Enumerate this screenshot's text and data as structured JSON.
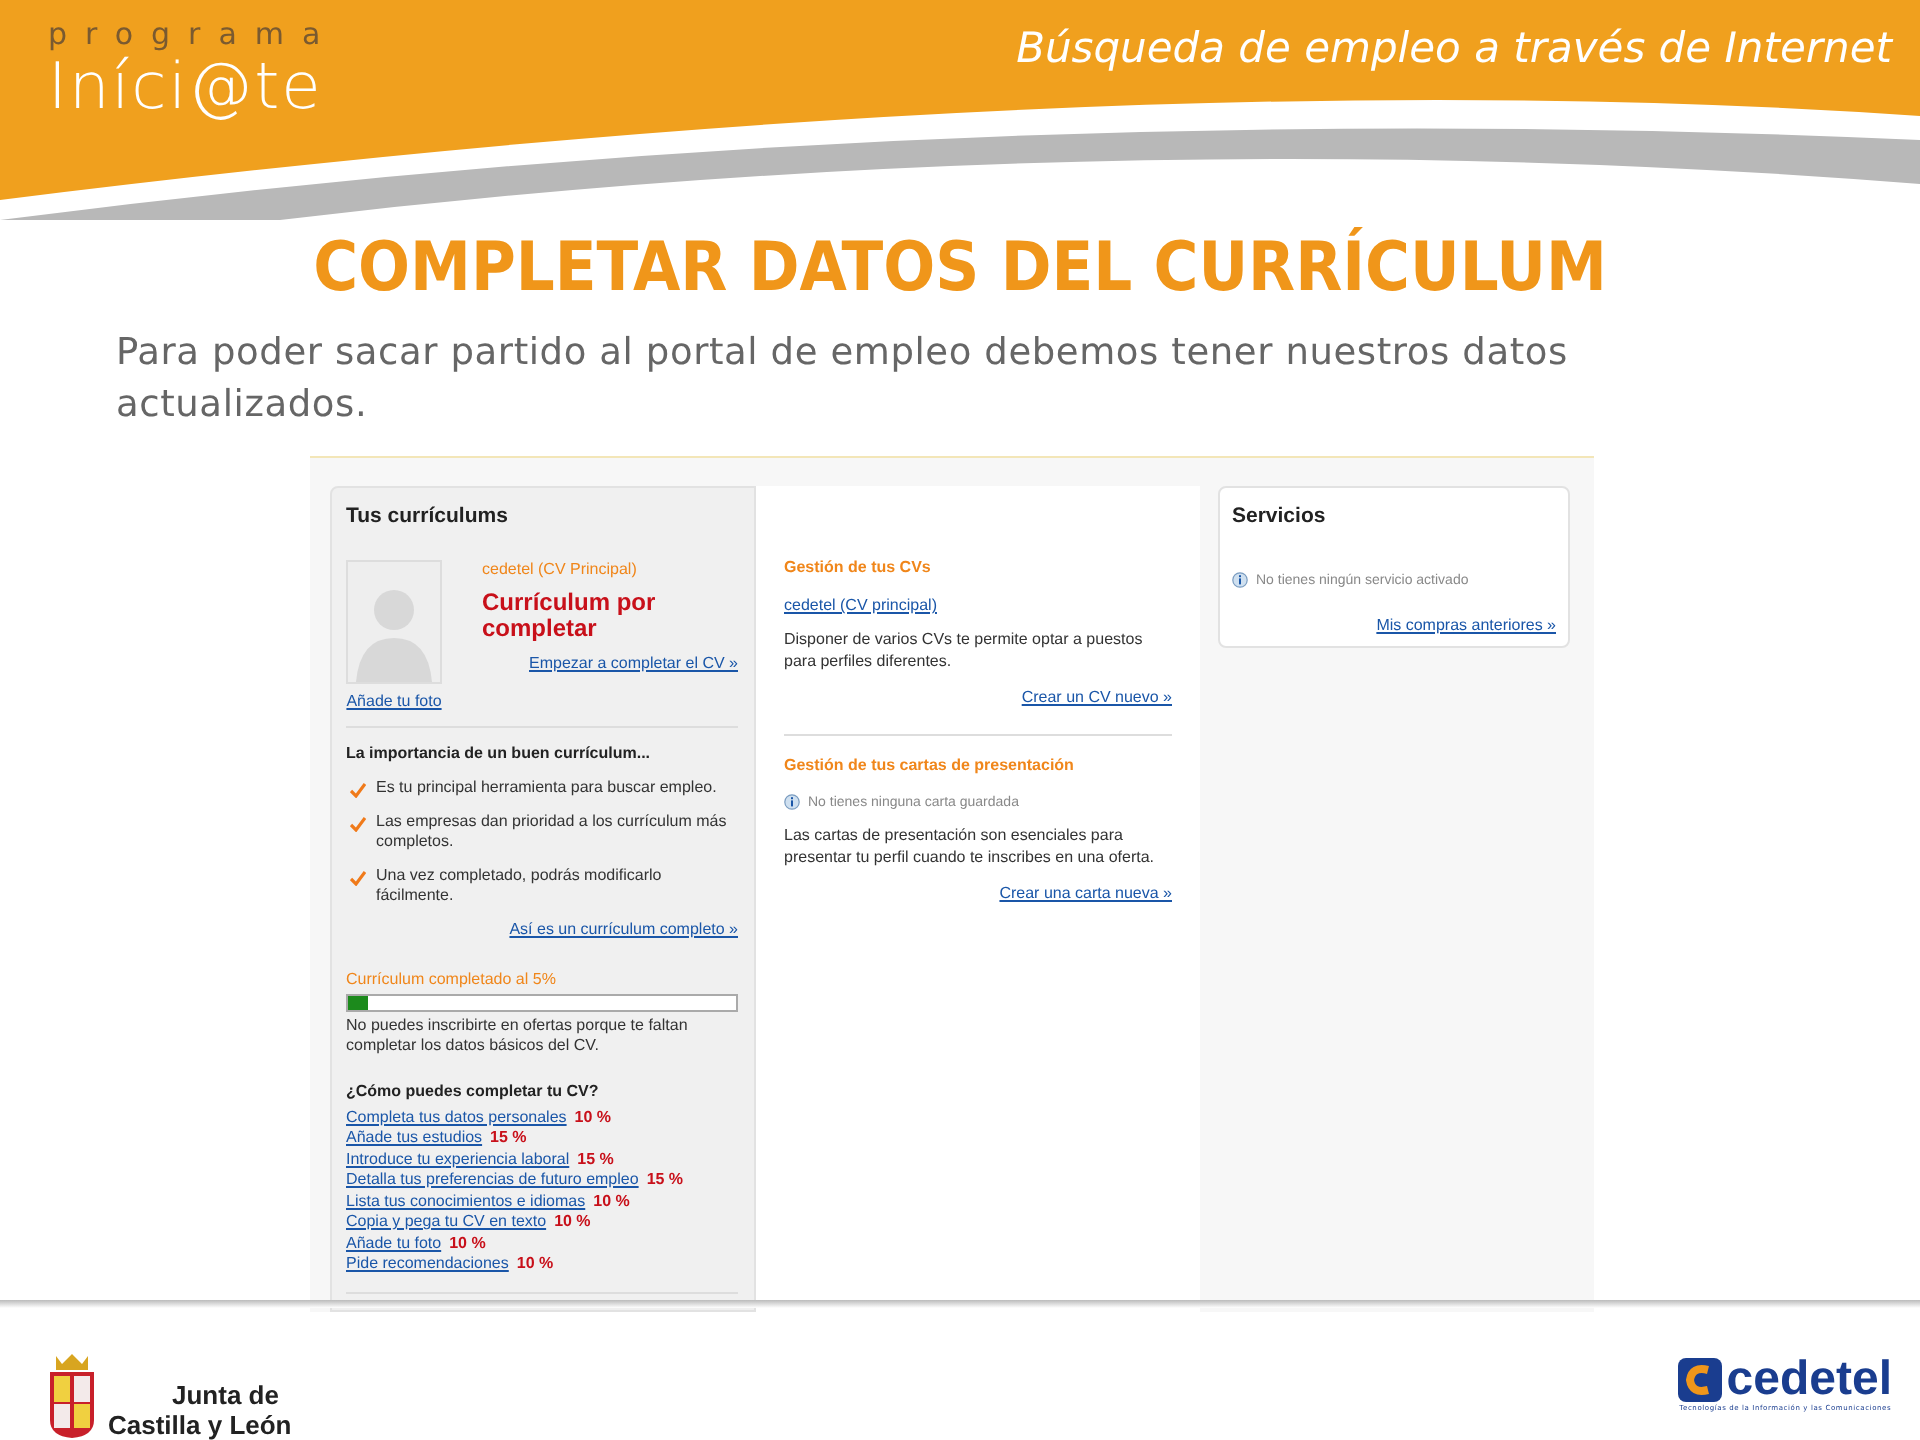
{
  "header": {
    "logo_small": "programa",
    "logo_main": "Iníci@te",
    "title": "Búsqueda de empleo a través de Internet"
  },
  "page_title": "COMPLETAR DATOS DEL CURRÍCULUM",
  "intro": "Para poder sacar partido al portal de empleo debemos tener nuestros datos actualizados.",
  "screenshot": {
    "left_panel": {
      "title": "Tus currículums",
      "cv_name": "cedetel (CV Principal)",
      "cv_status": "Currículum por completar",
      "photo_link": "Añade tu foto",
      "start_link": "Empezar a completar el CV »",
      "importance_title": "La importancia de un buen currículum...",
      "points": [
        "Es tu principal herramienta para buscar empleo.",
        "Las empresas dan prioridad a los currículum más completos.",
        "Una vez completado, podrás modificarlo fácilmente."
      ],
      "example_link": "Así es un currículum completo »",
      "progress": {
        "label": "Currículum completado al 5%",
        "level": 0.05,
        "note": "No puedes inscribirte en ofertas porque te faltan completar los datos básicos del CV."
      },
      "how_title": "¿Cómo puedes completar tu CV?",
      "steps": [
        {
          "link": "Completa tus datos personales",
          "percent": "10 %"
        },
        {
          "link": "Añade tus estudios",
          "percent": "15 %"
        },
        {
          "link": "Introduce tu experiencia laboral",
          "percent": "15 %"
        },
        {
          "link": "Detalla tus preferencias de futuro empleo",
          "percent": "15 %"
        },
        {
          "link": "Lista tus conocimientos e idiomas",
          "percent": "10 %"
        },
        {
          "link": "Copia y pega tu CV en texto",
          "percent": "10 %"
        },
        {
          "link": "Añade tu foto",
          "percent": "10 %"
        },
        {
          "link": "Pide recomendaciones",
          "percent": "10 %"
        }
      ]
    },
    "middle_panel": {
      "sections": [
        {
          "title": "Gestión de tus CVs",
          "link": "cedetel (CV principal)",
          "text": "Disponer de varios CVs te permite optar a puestos para perfiles diferentes.",
          "action": "Crear un CV nuevo »"
        },
        {
          "title": "Gestión de tus cartas de presentación",
          "info": "No tienes ninguna carta guardada",
          "text": "Las cartas de presentación son esenciales para presentar tu perfil cuando te inscribes en una oferta.",
          "action": "Crear una carta nueva »"
        }
      ]
    },
    "right_panel": {
      "title": "Servicios",
      "info": "No tienes ningún servicio activado",
      "link": "Mis compras anteriores »"
    }
  },
  "footer": {
    "junta": [
      "Junta de",
      "Castilla y León"
    ],
    "cedetel": "cedetel",
    "cedetel_tagline": "Tecnologías de la Información y las Comunicaciones"
  }
}
